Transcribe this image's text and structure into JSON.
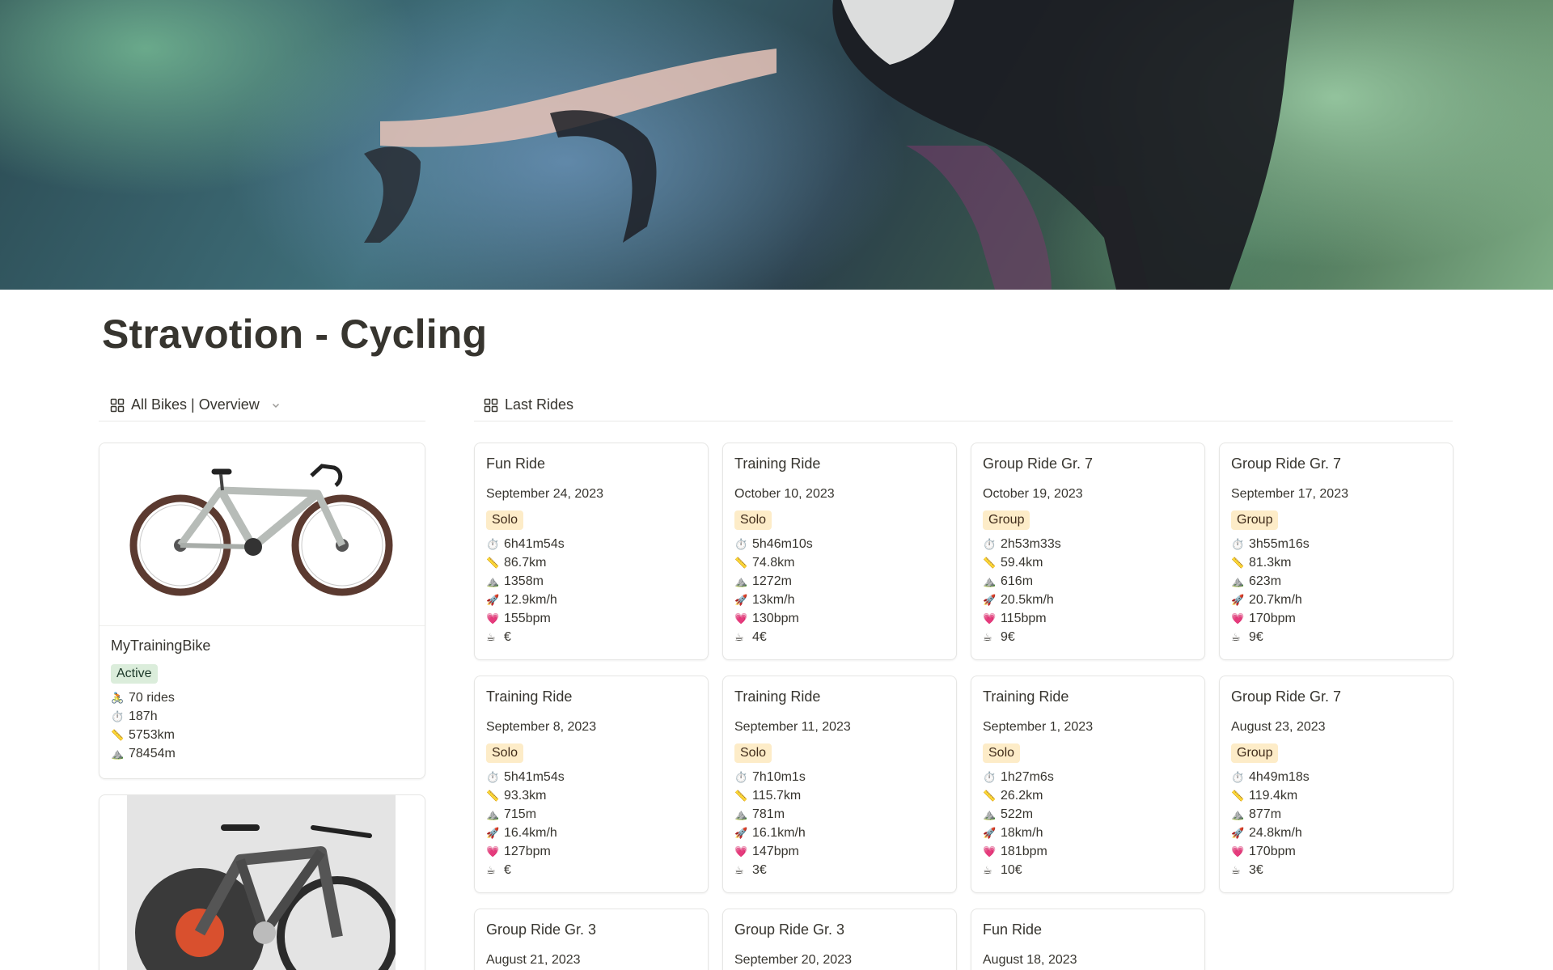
{
  "page": {
    "title": "Stravotion - Cycling"
  },
  "views": {
    "bikes": {
      "label": "All Bikes | Overview",
      "icon": "gallery-grid-icon"
    },
    "rides": {
      "label": "Last Rides",
      "icon": "gallery-grid-icon"
    }
  },
  "bikes": [
    {
      "name": "MyTrainingBike",
      "status": "Active",
      "rides": "70 rides",
      "hours": "187h",
      "distance": "5753km",
      "elevation": "78454m"
    }
  ],
  "rides": [
    {
      "title": "Fun Ride",
      "date": "September 24, 2023",
      "type": "Solo",
      "time": "6h41m54s",
      "distance": "86.7km",
      "elevation": "1358m",
      "speed": "12.9km/h",
      "heart": "155bpm",
      "coffee": "€"
    },
    {
      "title": "Training Ride",
      "date": "October 10, 2023",
      "type": "Solo",
      "time": "5h46m10s",
      "distance": "74.8km",
      "elevation": "1272m",
      "speed": "13km/h",
      "heart": "130bpm",
      "coffee": "4€"
    },
    {
      "title": "Group Ride Gr. 7",
      "date": "October 19, 2023",
      "type": "Group",
      "time": "2h53m33s",
      "distance": "59.4km",
      "elevation": "616m",
      "speed": "20.5km/h",
      "heart": "115bpm",
      "coffee": "9€"
    },
    {
      "title": "Group Ride Gr. 7",
      "date": "September 17, 2023",
      "type": "Group",
      "time": "3h55m16s",
      "distance": "81.3km",
      "elevation": "623m",
      "speed": "20.7km/h",
      "heart": "170bpm",
      "coffee": "9€"
    },
    {
      "title": "Training Ride",
      "date": "September 8, 2023",
      "type": "Solo",
      "time": "5h41m54s",
      "distance": "93.3km",
      "elevation": "715m",
      "speed": "16.4km/h",
      "heart": "127bpm",
      "coffee": "€"
    },
    {
      "title": "Training Ride",
      "date": "September 11, 2023",
      "type": "Solo",
      "time": "7h10m1s",
      "distance": "115.7km",
      "elevation": "781m",
      "speed": "16.1km/h",
      "heart": "147bpm",
      "coffee": "3€"
    },
    {
      "title": "Training Ride",
      "date": "September 1, 2023",
      "type": "Solo",
      "time": "1h27m6s",
      "distance": "26.2km",
      "elevation": "522m",
      "speed": "18km/h",
      "heart": "181bpm",
      "coffee": "10€"
    },
    {
      "title": "Group Ride Gr. 7",
      "date": "August 23, 2023",
      "type": "Group",
      "time": "4h49m18s",
      "distance": "119.4km",
      "elevation": "877m",
      "speed": "24.8km/h",
      "heart": "170bpm",
      "coffee": "3€"
    },
    {
      "title": "Group Ride Gr. 3",
      "date": "August 21, 2023"
    },
    {
      "title": "Group Ride Gr. 3",
      "date": "September 20, 2023"
    },
    {
      "title": "Fun Ride",
      "date": "August 18, 2023"
    }
  ],
  "emoji": {
    "bike": "🚴",
    "stopwatch": "⏱️",
    "ruler": "📏",
    "mountain": "⛰️",
    "rocket": "🚀",
    "heart": "💗",
    "coffee": "☕"
  }
}
